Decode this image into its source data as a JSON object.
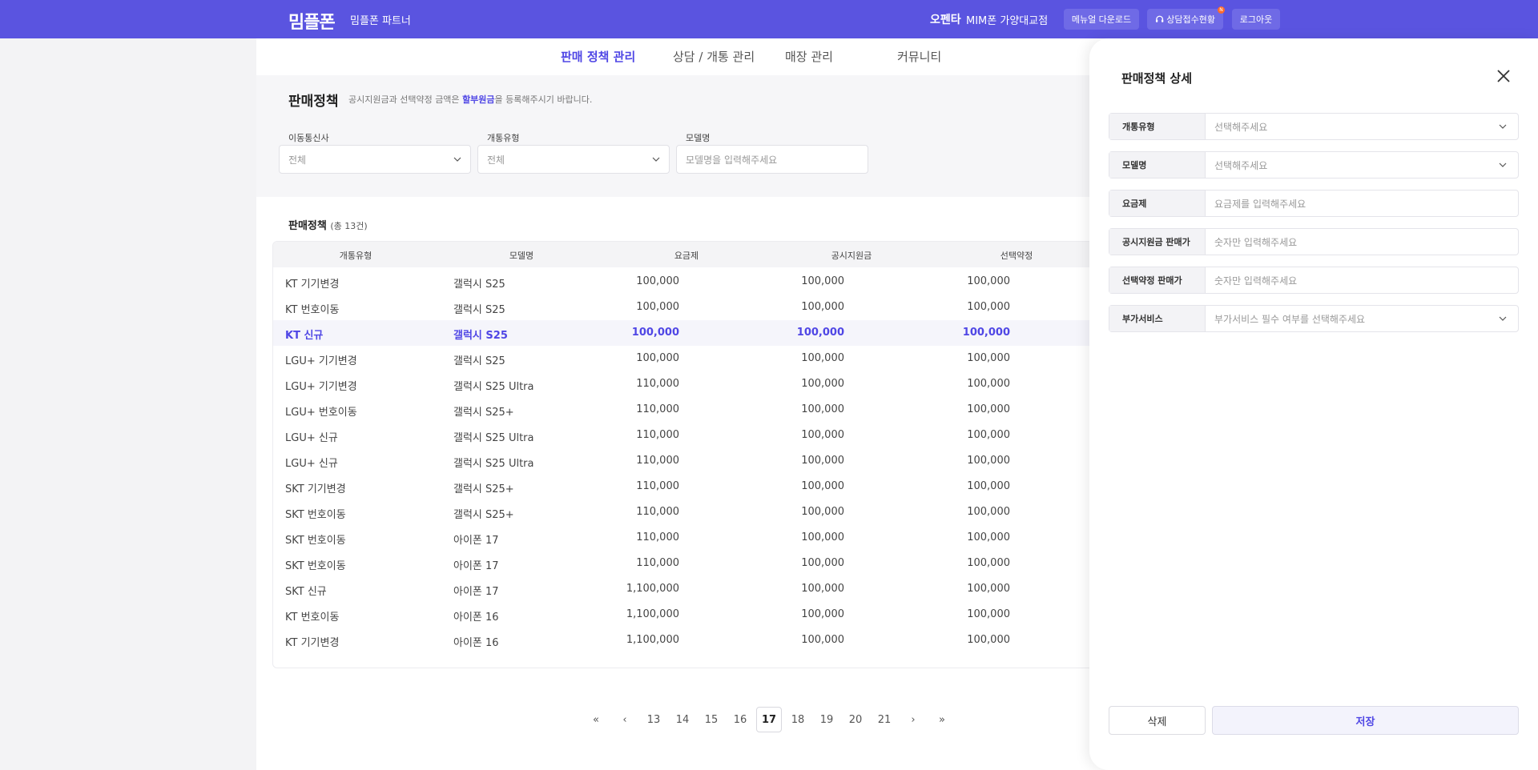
{
  "header": {
    "logo": "밈플폰",
    "partner_label": "밈플폰 파트너",
    "user_name": "오펜타",
    "store_name": "MIM폰 가양대교점",
    "manual_btn": "메뉴얼 다운로드",
    "consult_btn": "상담접수현황",
    "consult_badge": "N",
    "logout_btn": "로그아웃"
  },
  "nav": {
    "tabs": [
      "판매 정책 관리",
      "상담 / 개통 관리",
      "매장 관리",
      "커뮤니티"
    ]
  },
  "page": {
    "title": "판매정책",
    "desc_prefix": "공시지원금과 선택약정 금액은 ",
    "desc_highlight": "할부원금",
    "desc_suffix": "을 등록해주시기 바랍니다."
  },
  "filters": {
    "carrier_label": "이동통신사",
    "carrier_value": "전체",
    "activation_label": "개통유형",
    "activation_value": "전체",
    "model_label": "모델명",
    "model_placeholder": "모델명을 입력해주세요"
  },
  "list": {
    "title": "판매정책",
    "count": "(총 13건)",
    "columns": [
      "개통유형",
      "모델명",
      "요금제",
      "공시지원금",
      "선택약정"
    ],
    "rows": [
      [
        "KT 기기변경",
        "갤럭시 S25",
        "100,000",
        "100,000",
        "100,000"
      ],
      [
        "KT 번호이동",
        "갤럭시 S25",
        "100,000",
        "100,000",
        "100,000"
      ],
      [
        "KT 신규",
        "갤럭시 S25",
        "100,000",
        "100,000",
        "100,000"
      ],
      [
        "LGU+ 기기변경",
        "갤럭시 S25",
        "100,000",
        "100,000",
        "100,000"
      ],
      [
        "LGU+ 기기변경",
        "갤럭시 S25 Ultra",
        "110,000",
        "100,000",
        "100,000"
      ],
      [
        "LGU+ 번호이동",
        "갤럭시 S25+",
        "110,000",
        "100,000",
        "100,000"
      ],
      [
        "LGU+ 신규",
        "갤럭시 S25 Ultra",
        "110,000",
        "100,000",
        "100,000"
      ],
      [
        "LGU+ 신규",
        "갤럭시 S25 Ultra",
        "110,000",
        "100,000",
        "100,000"
      ],
      [
        "SKT 기기변경",
        "갤럭시 S25+",
        "110,000",
        "100,000",
        "100,000"
      ],
      [
        "SKT 번호이동",
        "갤럭시 S25+",
        "110,000",
        "100,000",
        "100,000"
      ],
      [
        "SKT 번호이동",
        "아이폰 17",
        "110,000",
        "100,000",
        "100,000"
      ],
      [
        "SKT 번호이동",
        "아이폰 17",
        "110,000",
        "100,000",
        "100,000"
      ],
      [
        "SKT 신규",
        "아이폰 17",
        "1,100,000",
        "100,000",
        "100,000"
      ],
      [
        "KT 번호이동",
        "아이폰 16",
        "1,100,000",
        "100,000",
        "100,000"
      ],
      [
        "KT 기기변경",
        "아이폰 16",
        "1,100,000",
        "100,000",
        "100,000"
      ]
    ],
    "selected_row": 2
  },
  "pagination": {
    "pages": [
      "13",
      "14",
      "15",
      "16",
      "17",
      "18",
      "19",
      "20",
      "21"
    ],
    "current": "17",
    "first": "«",
    "prev": "‹",
    "next": "›",
    "last": "»"
  },
  "drawer": {
    "title": "판매정책 상세",
    "fields": [
      {
        "label": "개통유형",
        "placeholder": "선택해주세요",
        "type": "select"
      },
      {
        "label": "모델명",
        "placeholder": "선택해주세요",
        "type": "select"
      },
      {
        "label": "요금제",
        "placeholder": "요금제를 입력해주세요",
        "type": "input"
      },
      {
        "label": "공시지원금 판매가",
        "placeholder": "숫자만 입력해주세요",
        "type": "input"
      },
      {
        "label": "선택약정 판매가",
        "placeholder": "숫자만 입력해주세요",
        "type": "input"
      },
      {
        "label": "부가서비스",
        "placeholder": "부가서비스 필수 여부를 선택해주세요",
        "type": "select"
      }
    ],
    "delete_btn": "삭제",
    "save_btn": "저장"
  },
  "colors": {
    "brand": "#5a54e0",
    "accent": "#4f46e5",
    "badge": "#ff6b2b"
  }
}
